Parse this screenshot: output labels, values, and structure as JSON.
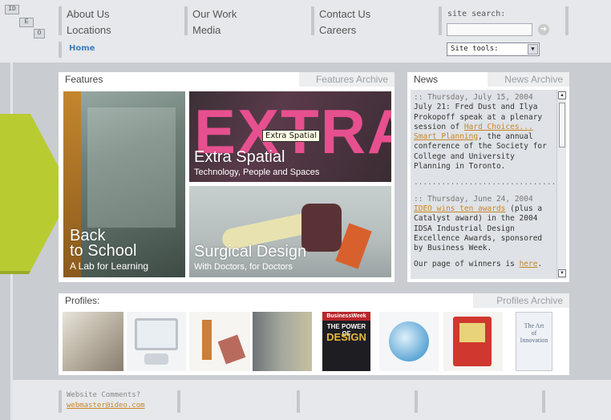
{
  "logo": {
    "cells": [
      "ID",
      "E",
      "O"
    ]
  },
  "nav": {
    "col1": [
      "About Us",
      "Locations"
    ],
    "col2": [
      "Our Work",
      "Media"
    ],
    "col3": [
      "Contact Us",
      "Careers"
    ],
    "home": "Home"
  },
  "search": {
    "label": "site search:",
    "value": "",
    "tools_selected": "Site tools:"
  },
  "features": {
    "tab": "Features",
    "archive": "Features Archive",
    "items": [
      {
        "title_line1": "Back",
        "title_line2": "to School",
        "subtitle": "A Lab for Learning"
      },
      {
        "title": "Extra Spatial",
        "subtitle": "Technology, People and Spaces",
        "backdrop": "EXTRA"
      },
      {
        "title": "Surgical Design",
        "subtitle": "With Doctors, for Doctors"
      }
    ],
    "tooltip": "Extra Spatial"
  },
  "news": {
    "tab": "News",
    "archive": "News Archive",
    "entries": [
      {
        "date": "Thursday, July 15, 2004",
        "text_before": "July 21: Fred Dust and Ilya Prokopoff speak at a plenary session of ",
        "link": "Hard Choices... Smart Planning",
        "text_after": ", the annual conference of the Society for College and University Planning in Toronto."
      },
      {
        "date": "Thursday, June 24, 2004",
        "link": "IDEO wins ten awards",
        "text_after": " (plus a Catalyst award) in the 2004 IDSA Industrial Design Excellence Awards, sponsored by Business Week."
      }
    ],
    "divider": "......................................",
    "closing_before": "Our page of winners is ",
    "closing_link": "here",
    "closing_after": "."
  },
  "profiles": {
    "tab": "Profiles:",
    "archive": "Profiles Archive",
    "thumbs": [
      {
        "alt": "book stack"
      },
      {
        "alt": "monitor screen"
      },
      {
        "alt": "robot figures"
      },
      {
        "alt": "exhibit hall"
      },
      {
        "alt": "magazine cover",
        "line1": "BusinessWeek",
        "line2": "THE POWER OF",
        "line3": "DESIGN"
      },
      {
        "alt": "blue device"
      },
      {
        "alt": "red kiosk"
      },
      {
        "alt": "art book",
        "line1": "The Art",
        "line2": "of",
        "line3": "Innovation"
      }
    ]
  },
  "footer": {
    "label": "Website Comments?",
    "email": "webmaster@ideo.com"
  },
  "colors": {
    "accent": "#3a7fc1",
    "link": "#c7862a",
    "green": "#b8cc32",
    "background": "#c9ccd0"
  }
}
